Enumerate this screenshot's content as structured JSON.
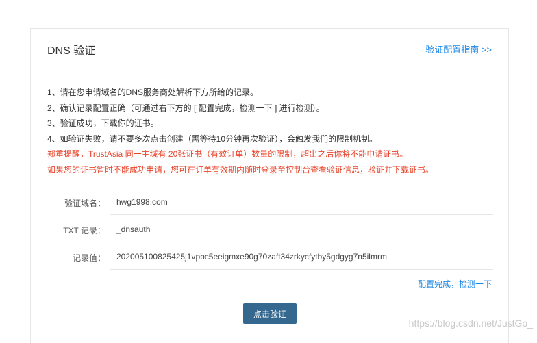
{
  "header": {
    "title": "DNS 验证",
    "guide_link": "验证配置指南 >>"
  },
  "notes": [
    "1、请在您申请域名的DNS服务商处解析下方所给的记录。",
    "2、确认记录配置正确（可通过右下方的 [ 配置完成，检测一下 ] 进行检测）。",
    "3、验证成功，下载你的证书。",
    "4、如验证失败，请不要多次点击创建（需等待10分钟再次验证），会触发我们的限制机制。"
  ],
  "warnings": [
    "郑重提醒，TrustAsia 同一主域有 20张证书（有效订单）数量的限制，超出之后你将不能申请证书。",
    "如果您的证书暂时不能成功申请，您可在订单有效期内随时登录至控制台查看验证信息，验证并下载证书。"
  ],
  "form": {
    "domain_label": "验证域名：",
    "domain_value": "hwg1998.com",
    "txt_label": "TXT 记录：",
    "txt_value": "_dnsauth",
    "record_label": "记录值：",
    "record_value": "202005100825425j1vpbc5eeigmxe90g70zaft34zrkycfytby5gdgyg7n5ilmrm"
  },
  "check_link": "配置完成，检测一下",
  "verify_button": "点击验证",
  "watermark": "https://blog.csdn.net/JustGo_"
}
